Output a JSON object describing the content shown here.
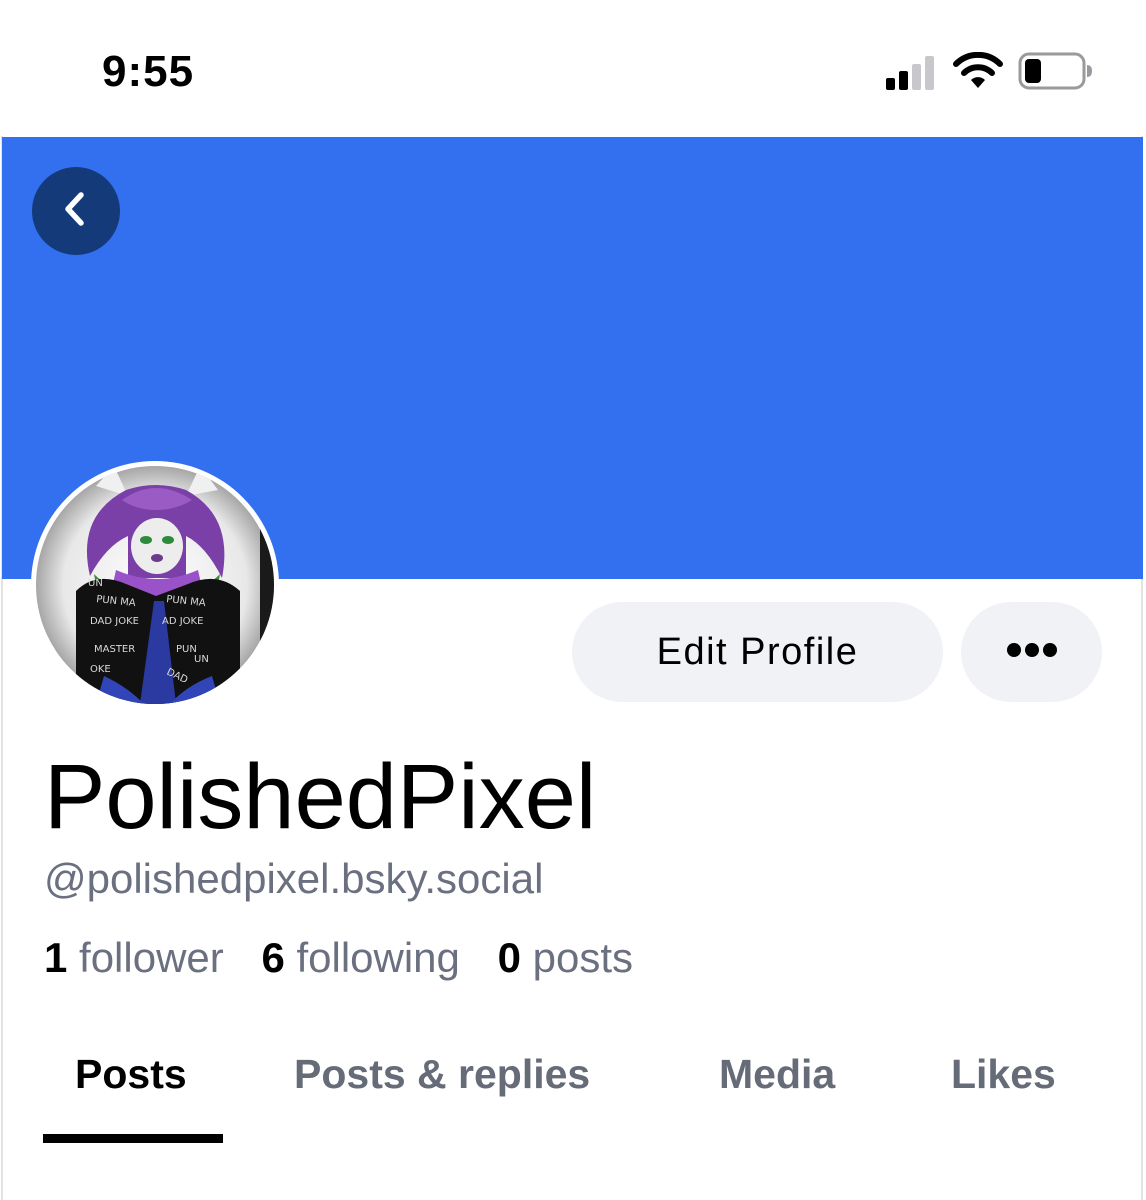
{
  "status_bar": {
    "time": "9:55",
    "icons": [
      "signal-icon",
      "wifi-icon",
      "battery-icon"
    ]
  },
  "header": {
    "back_icon": "chevron-left-icon",
    "banner_color": "#3270f0"
  },
  "profile": {
    "display_name": "PolishedPixel",
    "handle": "@polishedpixel.bsky.social",
    "edit_label": "Edit Profile",
    "more_icon": "ellipsis-icon",
    "avatar_text": [
      "UN",
      "PUN MA",
      "PUN MA",
      "DAD JOKE",
      "AD JOKE",
      "MASTER",
      "PUN",
      "OKE",
      "DAD",
      "UN"
    ]
  },
  "stats": {
    "followers_count": "1",
    "followers_label": "follower",
    "following_count": "6",
    "following_label": "following",
    "posts_count": "0",
    "posts_label": "posts"
  },
  "tabs": [
    {
      "label": "Posts",
      "active": true
    },
    {
      "label": "Posts & replies",
      "active": false
    },
    {
      "label": "Media",
      "active": false
    },
    {
      "label": "Likes",
      "active": false
    }
  ],
  "colors": {
    "accent": "#3270f0",
    "back_button": "#143a7a",
    "pill_bg": "#f1f2f6",
    "secondary_text": "#6b7080"
  }
}
